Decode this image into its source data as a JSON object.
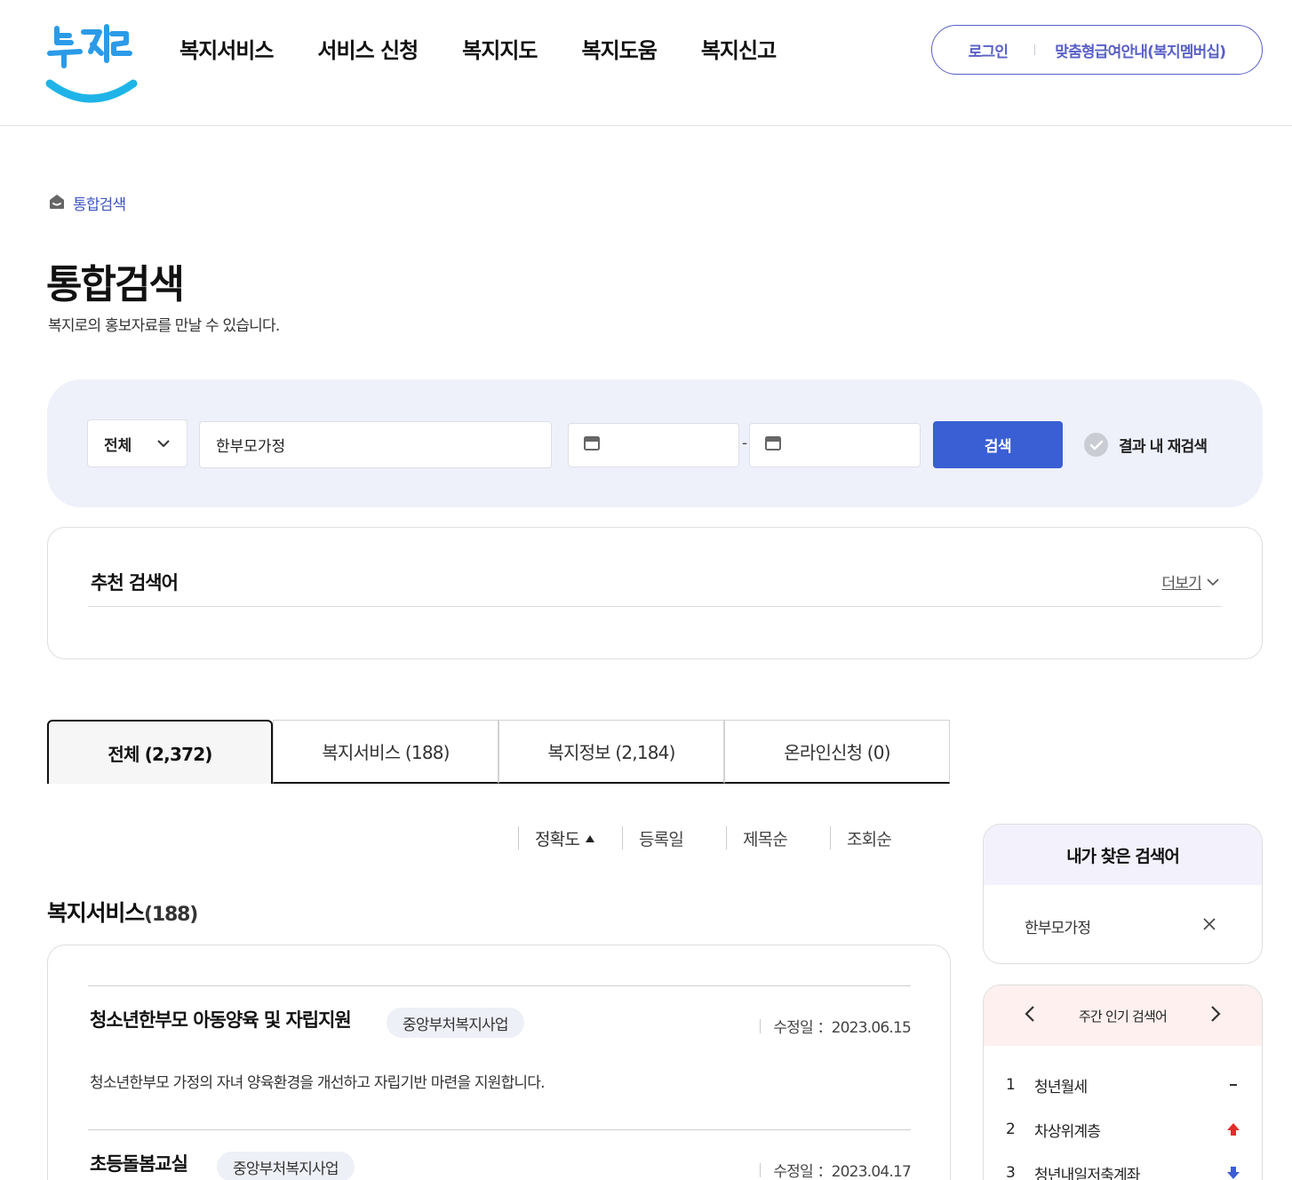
{
  "brand": {
    "logo_text": "복지로",
    "logo_color": "#2b9be8",
    "accent": "#3a5ed4"
  },
  "gnb": [
    "복지서비스",
    "서비스 신청",
    "복지지도",
    "복지도움",
    "복지신고"
  ],
  "util": {
    "login": "로그인",
    "membership": "맞춤형급여안내(복지멤버십)"
  },
  "breadcrumb": {
    "home_icon": "home-icon",
    "current": "통합검색"
  },
  "page": {
    "title": "통합검색",
    "description": "복지로의 홍보자료를 만날 수 있습니다."
  },
  "search": {
    "scope_selected": "전체",
    "keyword": "한부모가정",
    "date_from": "",
    "date_to": "",
    "date_separator": "-",
    "submit_label": "검색",
    "research_label": "결과 내 재검색"
  },
  "recommend": {
    "title": "추천 검색어",
    "more_label": "더보기"
  },
  "tabs": [
    {
      "label": "전체  (2,372)",
      "active": true
    },
    {
      "label": "복지서비스 (188)",
      "active": false
    },
    {
      "label": "복지정보 (2,184)",
      "active": false
    },
    {
      "label": "온라인신청 (0)",
      "active": false
    }
  ],
  "sort": [
    "정확도",
    "등록일",
    "제목순",
    "조회순"
  ],
  "section": {
    "title": "복지서비스",
    "count": "(188)"
  },
  "results": [
    {
      "title": "청소년한부모 아동양육 및 자립지원",
      "badge": "중앙부처복지사업",
      "date": "수정일 ：2023.06.15",
      "desc": "청소년한부모 가정의 자녀 양육환경을 개선하고 자립기반 마련을 지원합니다."
    },
    {
      "title": "초등돌봄교실",
      "badge": "중앙부처복지사업",
      "date": "수정일 ：2023.04.17",
      "desc": ""
    }
  ],
  "my_keywords": {
    "title": "내가 찾은 검색어",
    "items": [
      "한부모가정"
    ]
  },
  "popular": {
    "title": "주간 인기 검색어",
    "items": [
      {
        "rank": "1",
        "keyword": "청년월세",
        "trend": "same",
        "trend_color": "#333333"
      },
      {
        "rank": "2",
        "keyword": "차상위계층",
        "trend": "up",
        "trend_color": "#e52b2b"
      },
      {
        "rank": "3",
        "keyword": "청년내일저축계좌",
        "trend": "down",
        "trend_color": "#3a5ed4"
      }
    ]
  }
}
